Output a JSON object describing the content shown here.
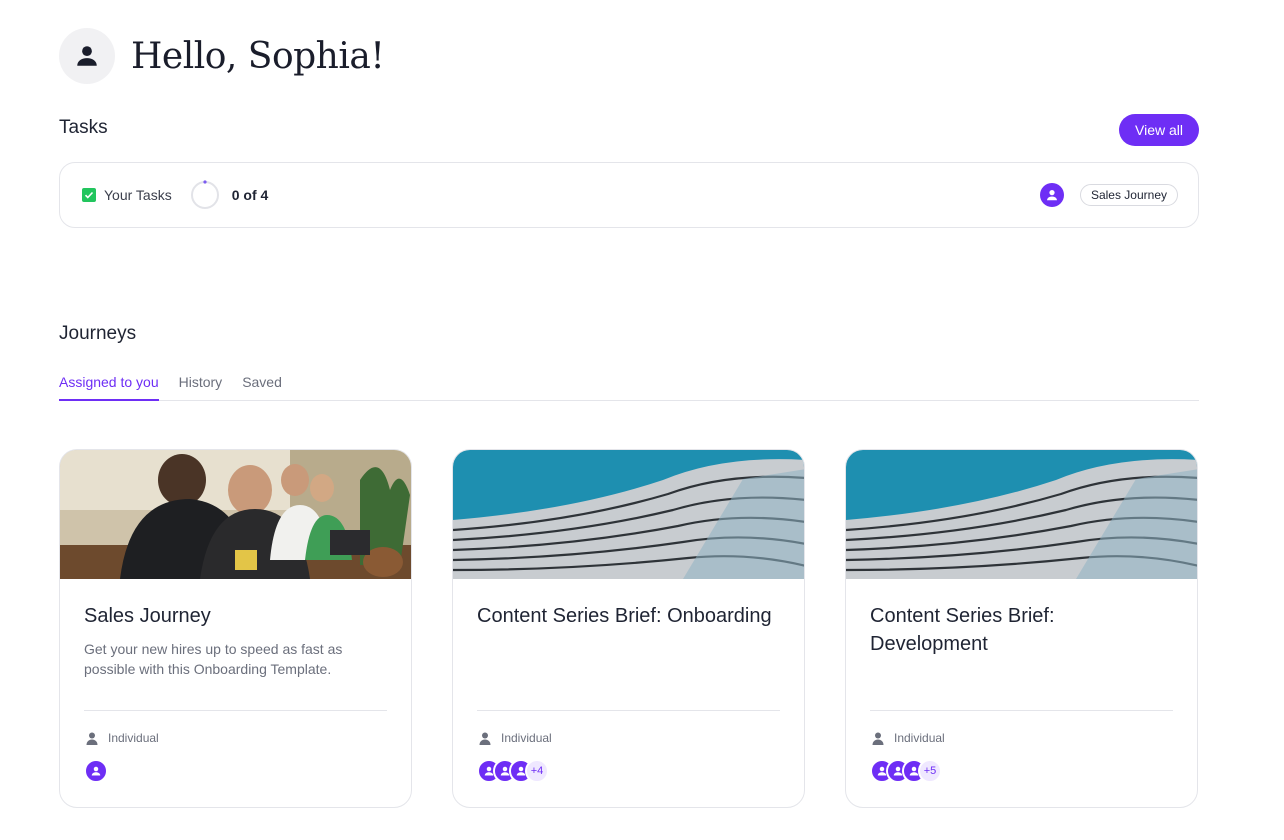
{
  "greeting": {
    "title": "Hello, Sophia!",
    "avatar_icon": "user-icon"
  },
  "tasks": {
    "title": "Tasks",
    "view_all_label": "View all",
    "your_tasks_label": "Your Tasks",
    "count_text": "0 of 4",
    "progress": 0.0,
    "journey_chip": "Sales Journey"
  },
  "journeys": {
    "title": "Journeys",
    "tabs": [
      {
        "label": "Assigned to you",
        "active": true
      },
      {
        "label": "History",
        "active": false
      },
      {
        "label": "Saved",
        "active": false
      }
    ],
    "cards": [
      {
        "title": "Sales Journey",
        "description": "Get your new hires up to speed as fast as possible with this Onboarding Template.",
        "type": "Individual",
        "image": "team-photo",
        "extra_assignees": ""
      },
      {
        "title": "Content Series Brief: Onboarding",
        "description": "",
        "type": "Individual",
        "image": "architecture-photo",
        "extra_assignees": "+4"
      },
      {
        "title": "Content Series Brief: Development",
        "description": "",
        "type": "Individual",
        "image": "architecture-photo",
        "extra_assignees": "+5"
      }
    ]
  },
  "colors": {
    "accent": "#6e2ef5",
    "check": "#22c55e",
    "border": "#e4e5ea"
  }
}
